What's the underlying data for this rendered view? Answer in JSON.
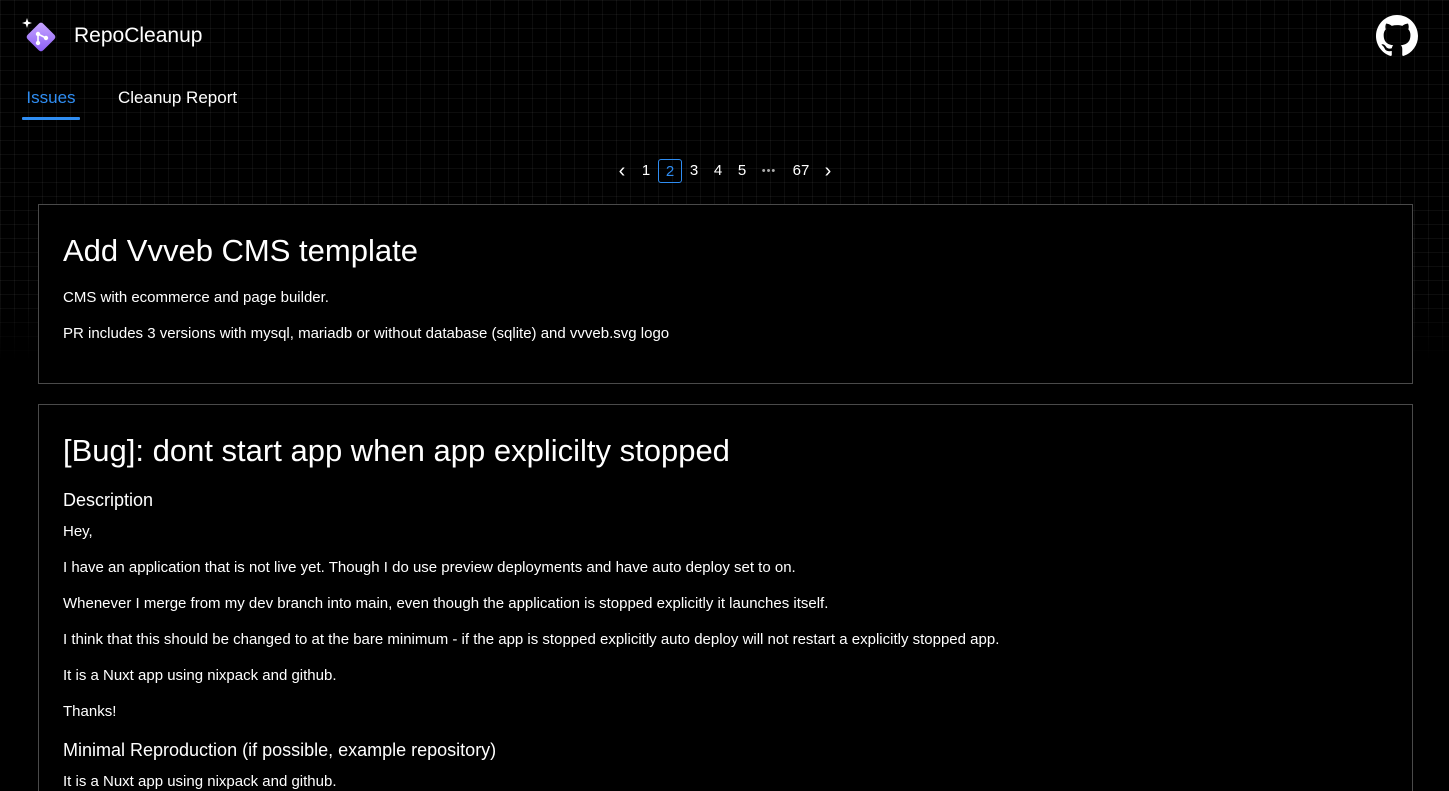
{
  "app": {
    "title": "RepoCleanup",
    "colors": {
      "accent": "#2f8df2",
      "background": "#000000",
      "border": "#4a4a4a"
    },
    "icons": {
      "logo": "git-sparkle-logo-icon",
      "github": "github-icon"
    }
  },
  "tabs": [
    {
      "label": "Issues",
      "active": true
    },
    {
      "label": "Cleanup Report",
      "active": false
    }
  ],
  "pagination": {
    "prev_icon": "‹",
    "pages": [
      "1",
      "2",
      "3",
      "4",
      "5"
    ],
    "current": "2",
    "ellipsis": "•••",
    "last": "67",
    "next_icon": "›"
  },
  "issues": [
    {
      "title": "Add Vvveb CMS template",
      "paragraphs": [
        "CMS with ecommerce and page builder.",
        "PR includes 3 versions with mysql, mariadb or without database (sqlite) and vvveb.svg logo"
      ]
    },
    {
      "title": "[Bug]: dont start app when app explicilty stopped",
      "sections": [
        {
          "heading": "Description",
          "paragraphs": [
            "Hey,",
            "I have an application that is not live yet. Though I do use preview deployments and have auto deploy set to on.",
            "Whenever I merge from my dev branch into main, even though the application is stopped explicitly it launches itself.",
            "I think that this should be changed to at the bare minimum - if the app is stopped explicitly auto deploy will not restart a explicitly stopped app.",
            "It is a Nuxt app using nixpack and github.",
            "Thanks!"
          ]
        },
        {
          "heading": "Minimal Reproduction (if possible, example repository)",
          "paragraphs": [
            "It is a Nuxt app using nixpack and github."
          ]
        }
      ]
    }
  ]
}
